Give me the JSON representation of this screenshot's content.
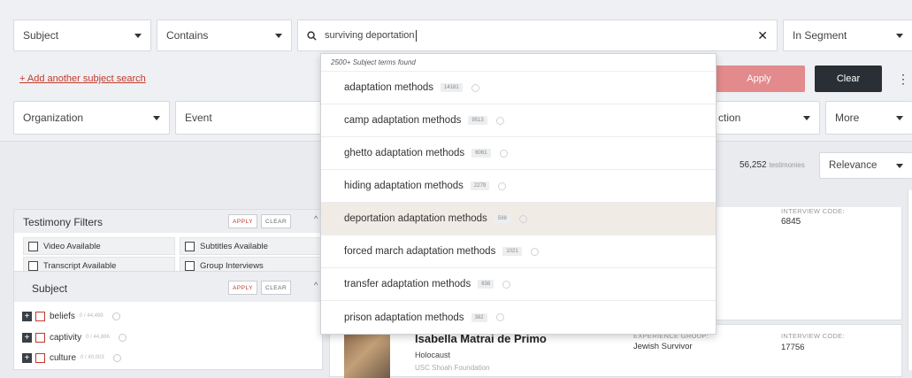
{
  "search_row": {
    "field_select": "Subject",
    "operator_select": "Contains",
    "query": "surviving deportation",
    "segment_select": "In Segment"
  },
  "add_search_link": "+ Add another subject search",
  "buttons": {
    "apply": "Apply",
    "clear": "Clear"
  },
  "facet_row": {
    "organization": "Organization",
    "event": "Event",
    "action_partial": "ction",
    "more": "More"
  },
  "results": {
    "count": "56,252",
    "count_suffix": "testimonies",
    "sort": "Relevance"
  },
  "testimony_filters": {
    "title": "Testimony Filters",
    "apply": "APPLY",
    "clear": "CLEAR",
    "options": [
      "Video Available",
      "Subtitles Available",
      "Transcript Available",
      "Group Interviews"
    ]
  },
  "subject_panel": {
    "title": "Subject",
    "apply": "APPLY",
    "clear": "CLEAR",
    "items": [
      {
        "label": "beliefs",
        "count": "0 / 44,499"
      },
      {
        "label": "captivity",
        "count": "0 / 44,886"
      },
      {
        "label": "culture",
        "count": "0 / 40,003"
      }
    ]
  },
  "autocomplete": {
    "header": "2500+ Subject terms found",
    "items": [
      {
        "label": "adaptation methods",
        "count": "14181"
      },
      {
        "label": "camp adaptation methods",
        "count": "9513"
      },
      {
        "label": "ghetto adaptation methods",
        "count": "6061"
      },
      {
        "label": "hiding adaptation methods",
        "count": "2279"
      },
      {
        "label": "deportation adaptation methods",
        "count": "598"
      },
      {
        "label": "forced march adaptation methods",
        "count": "1021"
      },
      {
        "label": "transfer adaptation methods",
        "count": "638"
      },
      {
        "label": "prison adaptation methods",
        "count": "382"
      }
    ]
  },
  "result_cards": [
    {
      "interview_label": "INTERVIEW CODE:",
      "interview_code": "6845"
    },
    {
      "name": "Isabella Matrai de Primo",
      "collection": "Holocaust",
      "org": "USC Shoah Foundation",
      "exp_label": "EXPERIENCE GROUP:",
      "exp_value": "Jewish Survivor",
      "interview_label": "INTERVIEW CODE:",
      "interview_code": "17756"
    }
  ]
}
